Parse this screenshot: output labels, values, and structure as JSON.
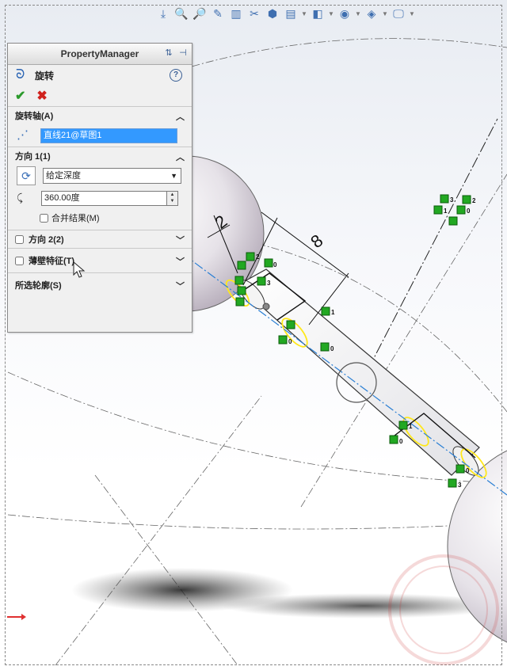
{
  "property_manager": {
    "title": "PropertyManager",
    "feature": "旋转",
    "axis_section": {
      "label": "旋转轴(A)",
      "value": "直线21@草图1"
    },
    "direction1": {
      "label": "方向 1(1)",
      "end_condition": "给定深度",
      "angle": "360.00度",
      "merge_result": "合并结果(M)"
    },
    "direction2": {
      "label": "方向 2(2)"
    },
    "thin_feature": {
      "label": "薄壁特征(T)"
    },
    "selected_contours": {
      "label": "所选轮廓(S)"
    }
  },
  "dimensions": {
    "d1": "2",
    "d2": "8"
  },
  "relations": [
    "2",
    "0",
    "3",
    "0",
    "1",
    "0",
    "0",
    "1",
    "0",
    "3",
    "3",
    "2",
    "1",
    "0"
  ],
  "colors": {
    "accent_green": "#22a822",
    "selection_blue": "#3399ff",
    "highlight_yellow": "#ffee33",
    "centerline_blue": "#2a7fd4"
  }
}
